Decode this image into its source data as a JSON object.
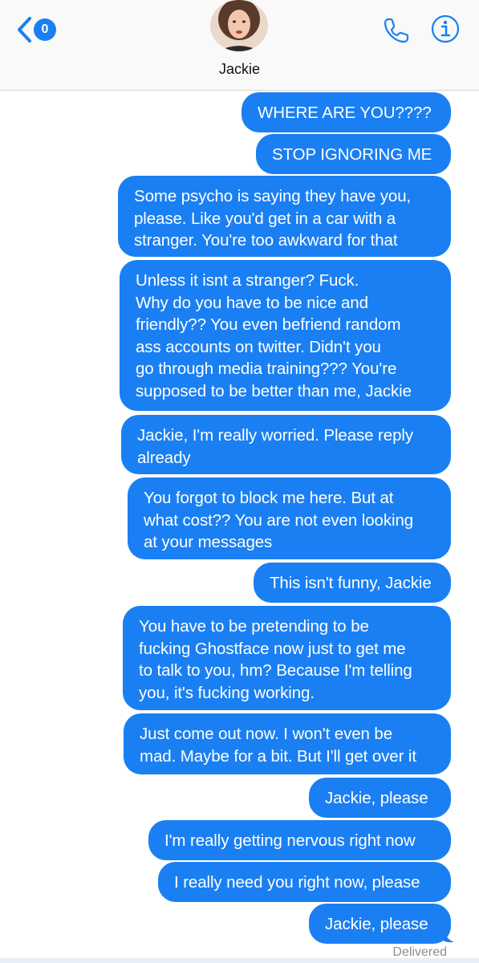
{
  "header": {
    "back_badge": "0",
    "contact_name": "Jackie",
    "back_icon": "chevron-left-icon",
    "phone_icon": "phone-icon",
    "info_icon": "info-icon",
    "accent_color": "#1a7ff2"
  },
  "messages": [
    {
      "text": "WHERE ARE YOU????",
      "direction": "outgoing"
    },
    {
      "text": "STOP IGNORING ME",
      "direction": "outgoing"
    },
    {
      "text": "Some psycho is saying they have you,\nplease. Like you'd get in a car with a\nstranger. You're too awkward for that",
      "direction": "outgoing"
    },
    {
      "text": "Unless it isnt a stranger? Fuck.\nWhy do you have to be nice and\nfriendly?? You even befriend random\nass accounts on twitter. Didn't you\ngo through media training??? You're\nsupposed to be better than me, Jackie",
      "direction": "outgoing"
    },
    {
      "text": "Jackie, I'm really worried. Please reply\nalready",
      "direction": "outgoing"
    },
    {
      "text": "You forgot to block me here. But at\nwhat cost?? You are not even looking\nat your messages",
      "direction": "outgoing"
    },
    {
      "text": "This isn't funny, Jackie",
      "direction": "outgoing"
    },
    {
      "text": "You have to be pretending to be\nfucking Ghostface now just to get me\nto talk to you, hm? Because I'm telling\nyou, it's fucking working.",
      "direction": "outgoing"
    },
    {
      "text": "Just come out now. I won't even be\nmad. Maybe for a bit. But I'll get over it",
      "direction": "outgoing"
    },
    {
      "text": "Jackie, please",
      "direction": "outgoing"
    },
    {
      "text": "I'm really getting nervous right now",
      "direction": "outgoing"
    },
    {
      "text": "I really need you right now, please",
      "direction": "outgoing"
    },
    {
      "text": "Jackie, please",
      "direction": "outgoing"
    }
  ],
  "status": {
    "delivered": "Delivered"
  }
}
